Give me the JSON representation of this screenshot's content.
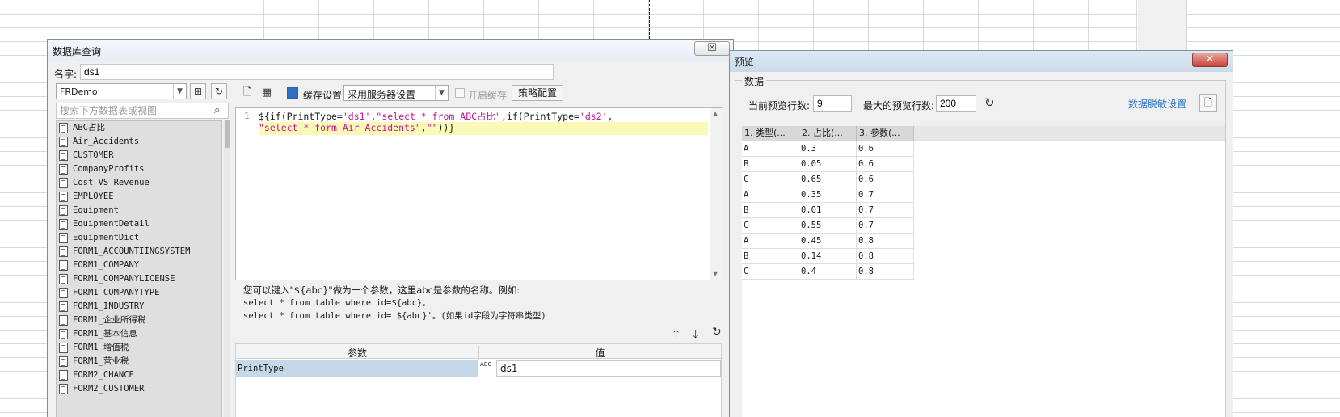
{
  "db_query": {
    "title": "数据库查询",
    "close": "☒",
    "name_label": "名字:",
    "name_value": "ds1",
    "connection": "FRDemo",
    "search_placeholder": "搜索下方数据表或视图",
    "tables": [
      "ABC占比",
      "Air_Accidents",
      "CUSTOMER",
      "CompanyProfits",
      "Cost_VS_Revenue",
      "EMPLOYEE",
      "Equipment",
      "EquipmentDetail",
      "EquipmentDict",
      "FORM1_ACCOUNTIINGSYSTEM",
      "FORM1_COMPANY",
      "FORM1_COMPANYLICENSE",
      "FORM1_COMPANYTYPE",
      "FORM1_INDUSTRY",
      "FORM1_企业所得税",
      "FORM1_基本信息",
      "FORM1_增值税",
      "FORM1_营业税",
      "FORM2_CHANCE",
      "FORM2_CUSTOMER"
    ],
    "toolbar": {
      "cache_label": "缓存设置",
      "cache_option": "采用服务器设置",
      "enable_cache_label": "开启缓存",
      "strategy_label": "策略配置"
    },
    "sql": {
      "line_number": "1",
      "line1_parts": [
        {
          "t": "${if(PrintType=",
          "c": "n"
        },
        {
          "t": "'ds1'",
          "c": "s"
        },
        {
          "t": ",",
          "c": "n"
        },
        {
          "t": "\"select * from ABC占比\"",
          "c": "s"
        },
        {
          "t": ",if(PrintType=",
          "c": "n"
        },
        {
          "t": "'ds2'",
          "c": "s"
        },
        {
          "t": ",",
          "c": "n"
        }
      ],
      "line2_parts": [
        {
          "t": "\"select * form Air_Accidents\"",
          "c": "s"
        },
        {
          "t": ",",
          "c": "n"
        },
        {
          "t": "\"\"",
          "c": "s"
        },
        {
          "t": "))}",
          "c": "n"
        }
      ]
    },
    "help": {
      "line1": "您可以键入\"${abc}\"做为一个参数，这里abc是参数的名称。例如:",
      "line2": "select * from table where id=${abc}。",
      "line3": "select * from table where id='${abc}'。(如果id字段为字符串类型)"
    },
    "params": {
      "col_param": "参数",
      "col_value": "值",
      "rows": [
        {
          "name": "PrintType",
          "type_icon": "ABC",
          "value": "ds1"
        }
      ]
    }
  },
  "preview": {
    "title": "预览",
    "close": "✕",
    "group_label": "数据",
    "current_rows_label": "当前预览行数:",
    "current_rows": "9",
    "max_rows_label": "最大的预览行数:",
    "max_rows": "200",
    "mask_link": "数据脱敏设置",
    "columns": [
      "1. 类型(...",
      "2. 占比(...",
      "3. 参数(..."
    ],
    "rows": [
      [
        "A",
        "0.3",
        "0.6"
      ],
      [
        "B",
        "0.05",
        "0.6"
      ],
      [
        "C",
        "0.65",
        "0.6"
      ],
      [
        "A",
        "0.35",
        "0.7"
      ],
      [
        "B",
        "0.01",
        "0.7"
      ],
      [
        "C",
        "0.55",
        "0.7"
      ],
      [
        "A",
        "0.45",
        "0.8"
      ],
      [
        "B",
        "0.14",
        "0.8"
      ],
      [
        "C",
        "0.4",
        "0.8"
      ]
    ]
  },
  "icons": [
    "preview-icon",
    "save-icon",
    "refresh-icon",
    "search-icon",
    "up-arrow-icon",
    "down-arrow-icon",
    "close-icon"
  ]
}
